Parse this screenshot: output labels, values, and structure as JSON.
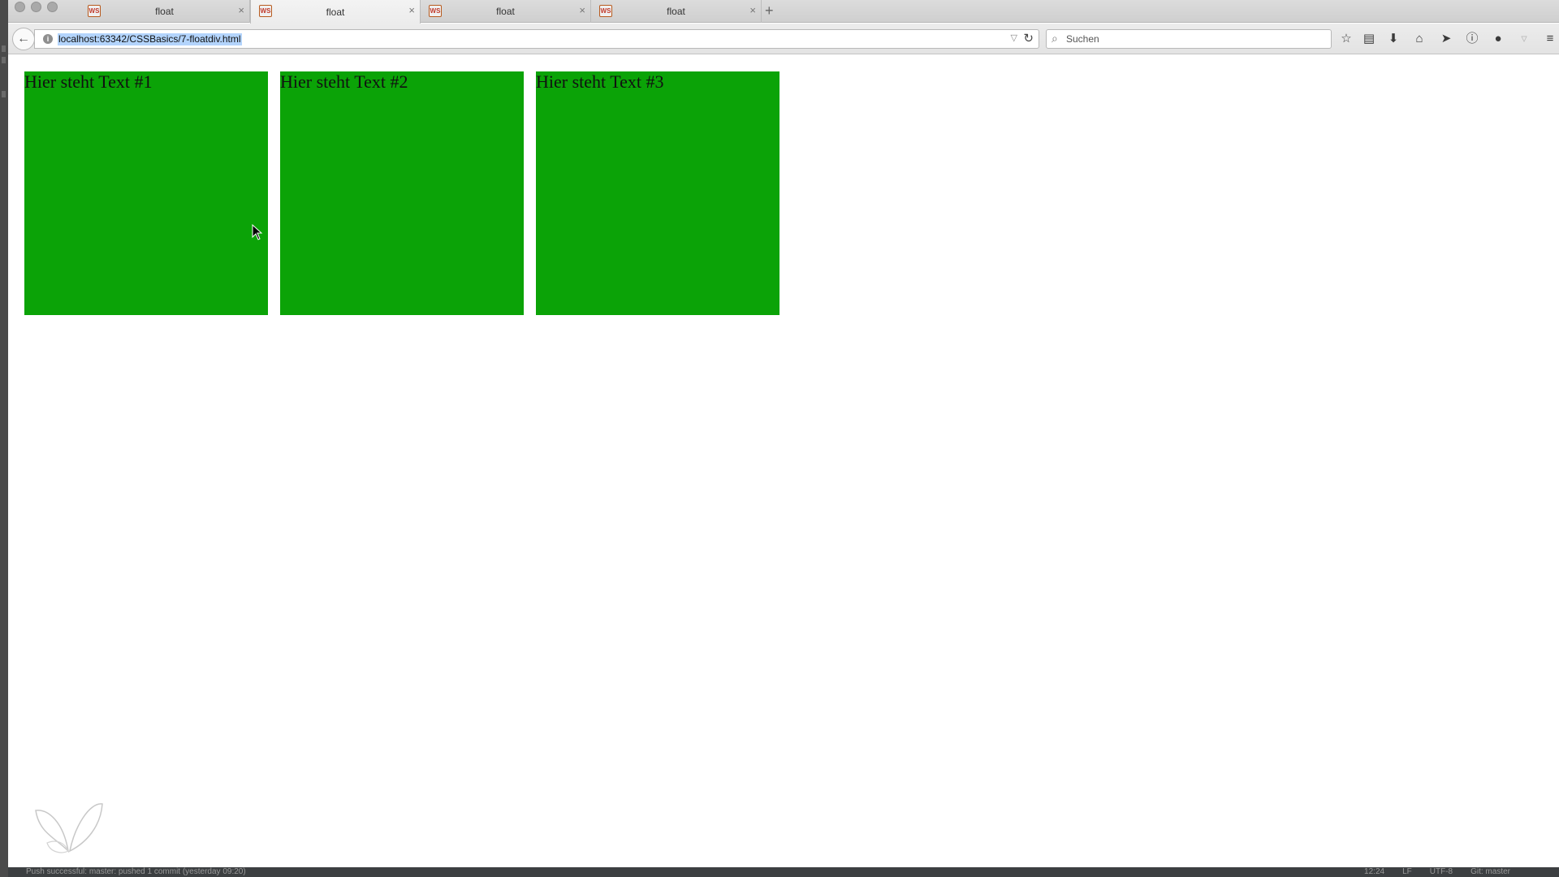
{
  "browser": {
    "tabs": [
      {
        "title": "float",
        "favicon": "ws-favicon",
        "active": false
      },
      {
        "title": "float",
        "favicon": "ws-favicon",
        "active": true
      },
      {
        "title": "float",
        "favicon": "ws-favicon",
        "active": false
      },
      {
        "title": "float",
        "favicon": "ws-favicon",
        "active": false
      }
    ],
    "tab_close_glyph": "×",
    "new_tab_glyph": "+",
    "url": "localhost:63342/CSSBasics/7-floatdiv.html",
    "search_placeholder": "Suchen",
    "toolbar_icons": [
      "star-icon",
      "reading-list-icon",
      "download-icon",
      "home-icon",
      "send-icon",
      "info-icon",
      "chat-icon",
      "shield-icon",
      "menu-icon"
    ]
  },
  "page": {
    "boxes": [
      {
        "text": "Hier steht Text #1"
      },
      {
        "text": "Hier steht Text #2"
      },
      {
        "text": "Hier steht Text #3"
      }
    ],
    "box_color": "#0ba307"
  },
  "ide_status": {
    "message": "Push successful: master: pushed 1 commit (yesterday 09:20)",
    "position": "12:24",
    "line_sep": "LF",
    "encoding": "UTF-8",
    "vcs": "Git: master"
  }
}
